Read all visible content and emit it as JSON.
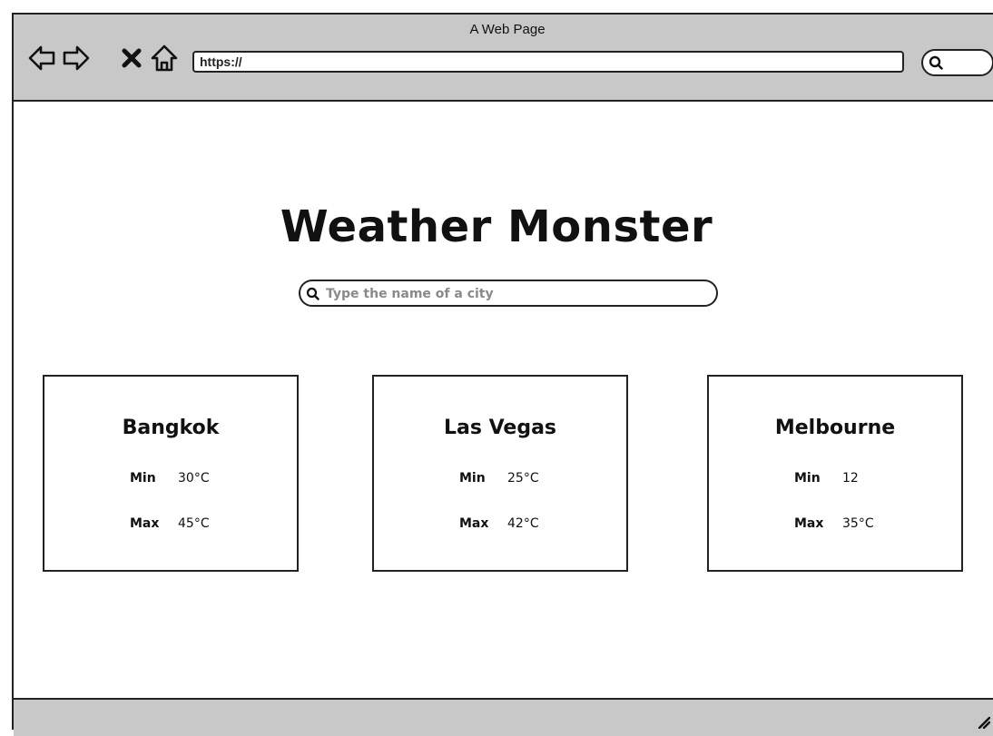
{
  "browser": {
    "window_title": "A Web Page",
    "url": "https://",
    "nav_icons": [
      "back-arrow-icon",
      "forward-arrow-icon",
      "close-x-icon",
      "home-icon"
    ]
  },
  "app": {
    "title": "Weather Monster",
    "search": {
      "placeholder": "Type the name of a city",
      "value": ""
    }
  },
  "cities": [
    {
      "name": "Bangkok",
      "min_label": "Min",
      "min": "30°C",
      "max_label": "Max",
      "max": "45°C"
    },
    {
      "name": "Las Vegas",
      "min_label": "Min",
      "min": "25°C",
      "max_label": "Max",
      "max": "42°C"
    },
    {
      "name": "Melbourne",
      "min_label": "Min",
      "min": "12",
      "max_label": "Max",
      "max": "35°C"
    }
  ]
}
